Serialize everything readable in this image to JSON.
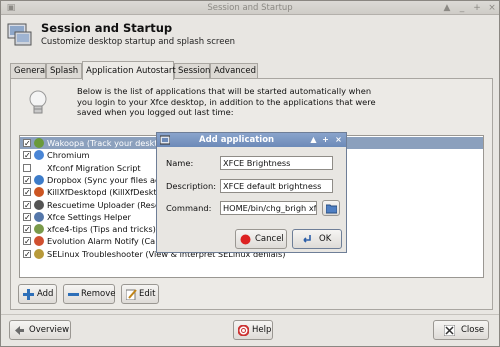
{
  "window": {
    "title": "Session and Startup"
  },
  "header": {
    "title": "Session and Startup",
    "subtitle": "Customize desktop startup and splash screen"
  },
  "tabs": [
    {
      "label": "General"
    },
    {
      "label": "Splash"
    },
    {
      "label": "Application Autostart"
    },
    {
      "label": "Session"
    },
    {
      "label": "Advanced"
    }
  ],
  "description": "Below is the list of applications that will be started automatically when you login to your Xfce desktop, in addition to the applications that were saved when you logged out last time:",
  "apps": [
    {
      "label": "Wakoopa (Track your deskto",
      "checked": true,
      "selected": true
    },
    {
      "label": "Chromium",
      "checked": true
    },
    {
      "label": "Xfconf Migration Script",
      "checked": false
    },
    {
      "label": "Dropbox (Sync your files ac",
      "checked": true
    },
    {
      "label": "KillXfDesktopd (KillXfDeskto",
      "checked": true
    },
    {
      "label": "Rescuetime Uploader (Resc",
      "checked": true
    },
    {
      "label": "Xfce Settings Helper",
      "checked": true
    },
    {
      "label": "xfce4-tips (Tips and tricks)",
      "checked": true
    },
    {
      "label": "Evolution Alarm Notify (Calendar event notifications)",
      "checked": true
    },
    {
      "label": "SELinux Troubleshooter (View & interpret SELinux denials)",
      "checked": true
    }
  ],
  "buttons": {
    "add": "Add",
    "remove": "Remove",
    "edit": "Edit",
    "overview": "Overview",
    "help": "Help",
    "close": "Close"
  },
  "dialog": {
    "title": "Add application",
    "name_label": "Name:",
    "name_value": "XFCE Brightness",
    "desc_label": "Description:",
    "desc_value": "XFCE default brightness",
    "cmd_label": "Command:",
    "cmd_value": "HOME/bin/chg_brigh xfce",
    "cancel": "Cancel",
    "ok": "OK"
  },
  "colors": {
    "selection": "#8ba0bd",
    "dialog_title": "#6c8ab8"
  }
}
